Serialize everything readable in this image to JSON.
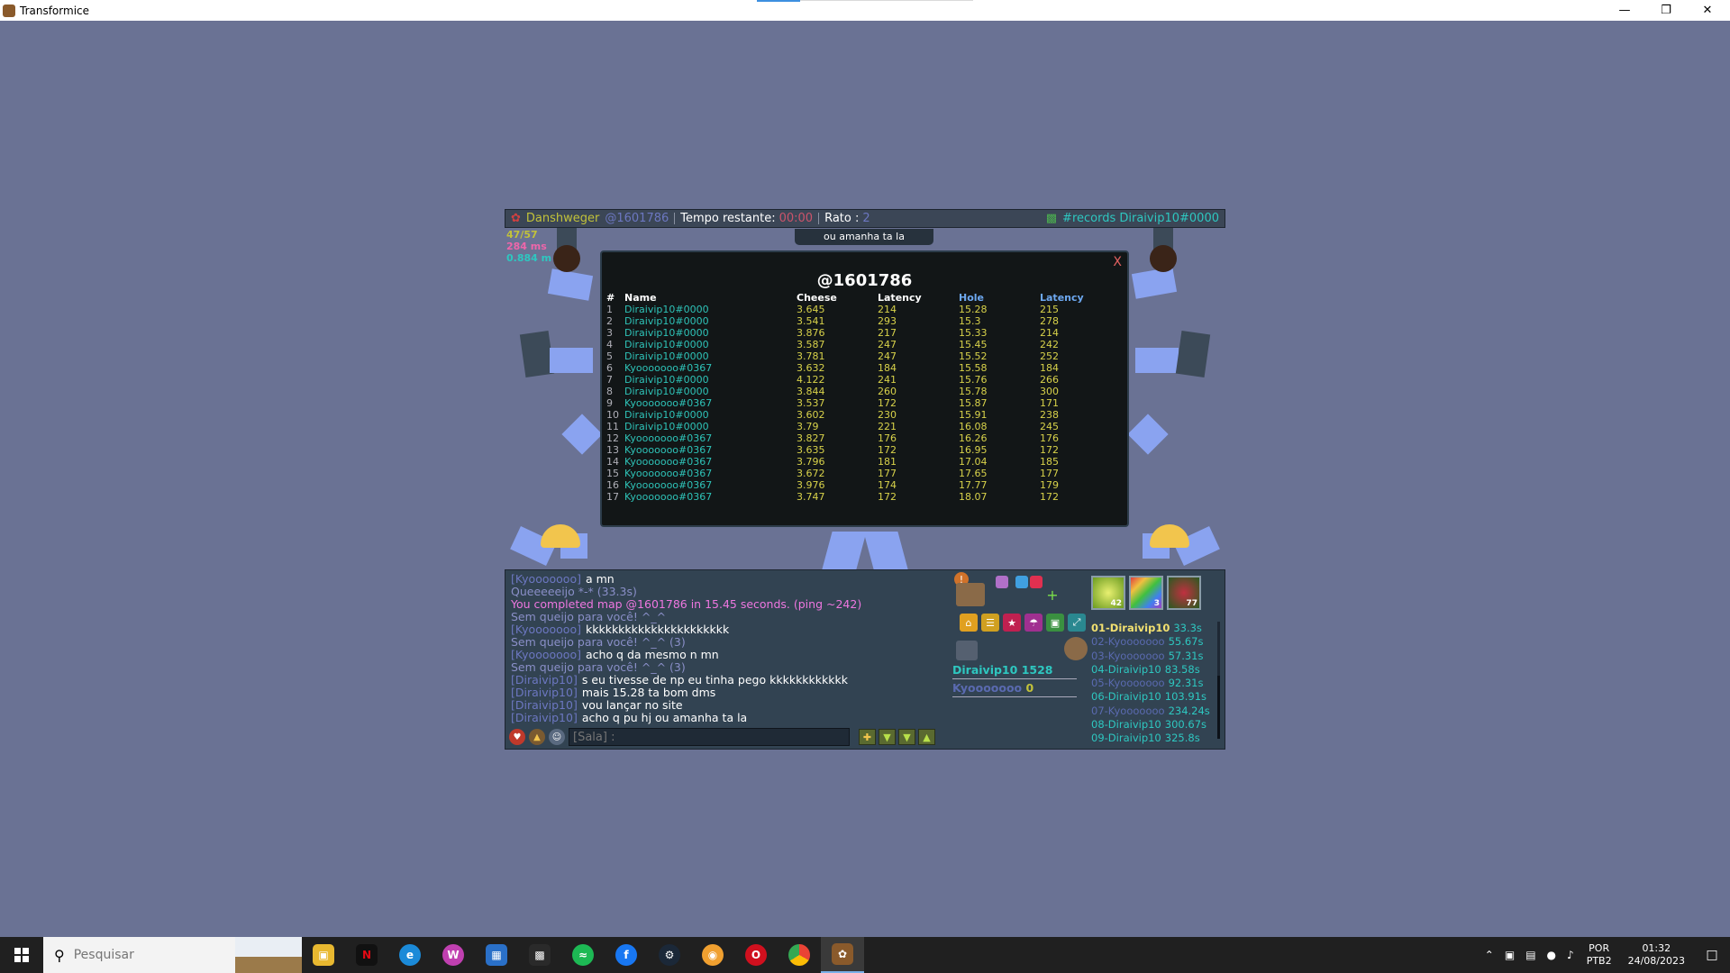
{
  "window": {
    "title": "Transformice"
  },
  "topbar": {
    "map_author": "Danshweger",
    "map_code": "@1601786",
    "time_label": "Tempo restante:",
    "time_value": "00:00",
    "mice_label": "Rato :",
    "mice_value": "2",
    "room": "#records Diraivip10#0000"
  },
  "bubble": "ou amanha ta la",
  "stats": {
    "fps": "47/57",
    "ms": "284 ms",
    "dist": "0.884 m"
  },
  "records": {
    "title": "@1601786",
    "close": "X",
    "headers": [
      "#",
      "Name",
      "Cheese",
      "Latency",
      "Hole",
      "Latency"
    ],
    "rows": [
      [
        "1",
        "Diraivip10#0000",
        "3.645",
        "214",
        "15.28",
        "215"
      ],
      [
        "2",
        "Diraivip10#0000",
        "3.541",
        "293",
        "15.3",
        "278"
      ],
      [
        "3",
        "Diraivip10#0000",
        "3.876",
        "217",
        "15.33",
        "214"
      ],
      [
        "4",
        "Diraivip10#0000",
        "3.587",
        "247",
        "15.45",
        "242"
      ],
      [
        "5",
        "Diraivip10#0000",
        "3.781",
        "247",
        "15.52",
        "252"
      ],
      [
        "6",
        "Kyooooooo#0367",
        "3.632",
        "184",
        "15.58",
        "184"
      ],
      [
        "7",
        "Diraivip10#0000",
        "4.122",
        "241",
        "15.76",
        "266"
      ],
      [
        "8",
        "Diraivip10#0000",
        "3.844",
        "260",
        "15.78",
        "300"
      ],
      [
        "9",
        "Kyooooooo#0367",
        "3.537",
        "172",
        "15.87",
        "171"
      ],
      [
        "10",
        "Diraivip10#0000",
        "3.602",
        "230",
        "15.91",
        "238"
      ],
      [
        "11",
        "Diraivip10#0000",
        "3.79",
        "221",
        "16.08",
        "245"
      ],
      [
        "12",
        "Kyooooooo#0367",
        "3.827",
        "176",
        "16.26",
        "176"
      ],
      [
        "13",
        "Kyooooooo#0367",
        "3.635",
        "172",
        "16.95",
        "172"
      ],
      [
        "14",
        "Kyooooooo#0367",
        "3.796",
        "181",
        "17.04",
        "185"
      ],
      [
        "15",
        "Kyooooooo#0367",
        "3.672",
        "177",
        "17.65",
        "177"
      ],
      [
        "16",
        "Kyooooooo#0367",
        "3.976",
        "174",
        "17.77",
        "179"
      ],
      [
        "17",
        "Kyooooooo#0367",
        "3.747",
        "172",
        "18.07",
        "172"
      ]
    ]
  },
  "chat": [
    {
      "who": "[Kyooooooo]",
      "text": "a mn",
      "style": "msg"
    },
    {
      "who": "",
      "text": "Queeeeeijo *-* (33.3s)",
      "style": "grey"
    },
    {
      "who": "",
      "text": "You completed map @1601786 in 15.45 seconds. (ping ~242)",
      "style": "pink"
    },
    {
      "who": "",
      "text": "Sem queijo para você! ^_^",
      "style": "grey"
    },
    {
      "who": "[Kyooooooo]",
      "text": "kkkkkkkkkkkkkkkkkkkkkk",
      "style": "msg"
    },
    {
      "who": "",
      "text": "Sem queijo para você! ^_^ (3)",
      "style": "grey"
    },
    {
      "who": "[Kyooooooo]",
      "text": "acho q da mesmo n mn",
      "style": "msg"
    },
    {
      "who": "",
      "text": "Sem queijo para você! ^_^ (3)",
      "style": "grey"
    },
    {
      "who": "[Diraivip10]",
      "text": "s eu tivesse de np eu tinha pego kkkkkkkkkkkk",
      "style": "msg"
    },
    {
      "who": "[Diraivip10]",
      "text": "mais 15.28 ta bom dms",
      "style": "msg"
    },
    {
      "who": "[Diraivip10]",
      "text": "vou lançar no site",
      "style": "msg"
    },
    {
      "who": "[Diraivip10]",
      "text": "acho q pu hj ou amanha ta la",
      "style": "msg"
    }
  ],
  "chatinput": {
    "prefix": "[Sala] :",
    "value": ""
  },
  "players": [
    {
      "name": "Diraivip10",
      "score": "1528"
    },
    {
      "name": "Kyooooooo",
      "score": "0"
    }
  ],
  "powers": [
    {
      "count": "42"
    },
    {
      "count": "3"
    },
    {
      "count": "77"
    }
  ],
  "ranking": [
    {
      "pos": "01-",
      "name": "Diraivip10",
      "time": "33.3s"
    },
    {
      "pos": "02-",
      "name": "Kyooooooo",
      "time": "55.67s"
    },
    {
      "pos": "03-",
      "name": "Kyooooooo",
      "time": "57.31s"
    },
    {
      "pos": "04-",
      "name": "Diraivip10",
      "time": "83.58s"
    },
    {
      "pos": "05-",
      "name": "Kyooooooo",
      "time": "92.31s"
    },
    {
      "pos": "06-",
      "name": "Diraivip10",
      "time": "103.91s"
    },
    {
      "pos": "07-",
      "name": "Kyooooooo",
      "time": "234.24s"
    },
    {
      "pos": "08-",
      "name": "Diraivip10",
      "time": "300.67s"
    },
    {
      "pos": "09-",
      "name": "Diraivip10",
      "time": "325.8s"
    }
  ],
  "taskbar": {
    "search_placeholder": "Pesquisar",
    "lang": "POR",
    "layout": "PTB2",
    "time": "01:32",
    "date": "24/08/2023"
  },
  "colors": {
    "background": "#6a7294",
    "accent_cyan": "#2ec7c0",
    "accent_gold": "#c2c23a"
  }
}
